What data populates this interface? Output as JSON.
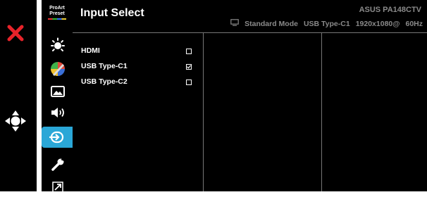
{
  "menu": {
    "title": "Input Select",
    "model": "ASUS PA148CTV",
    "status": {
      "mode": "Standard Mode",
      "input": "USB Type-C1",
      "resolution": "1920x1080@",
      "refresh": "60Hz"
    }
  },
  "preset": {
    "line1": "ProArt",
    "line2": "Preset"
  },
  "sidebar_icons": [
    "brightness-icon",
    "color-icon",
    "image-icon",
    "sound-icon",
    "input-select-icon",
    "wrench-icon",
    "shortcut-icon"
  ],
  "options": [
    {
      "label": "HDMI",
      "checked": false
    },
    {
      "label": "USB Type-C1",
      "checked": true
    },
    {
      "label": "USB Type-C2",
      "checked": false
    }
  ],
  "colors": {
    "accent": "#2aa7d7",
    "close": "#e8232a",
    "text": "#ffffff",
    "muted": "#8a8a8a",
    "bg": "#000000"
  }
}
